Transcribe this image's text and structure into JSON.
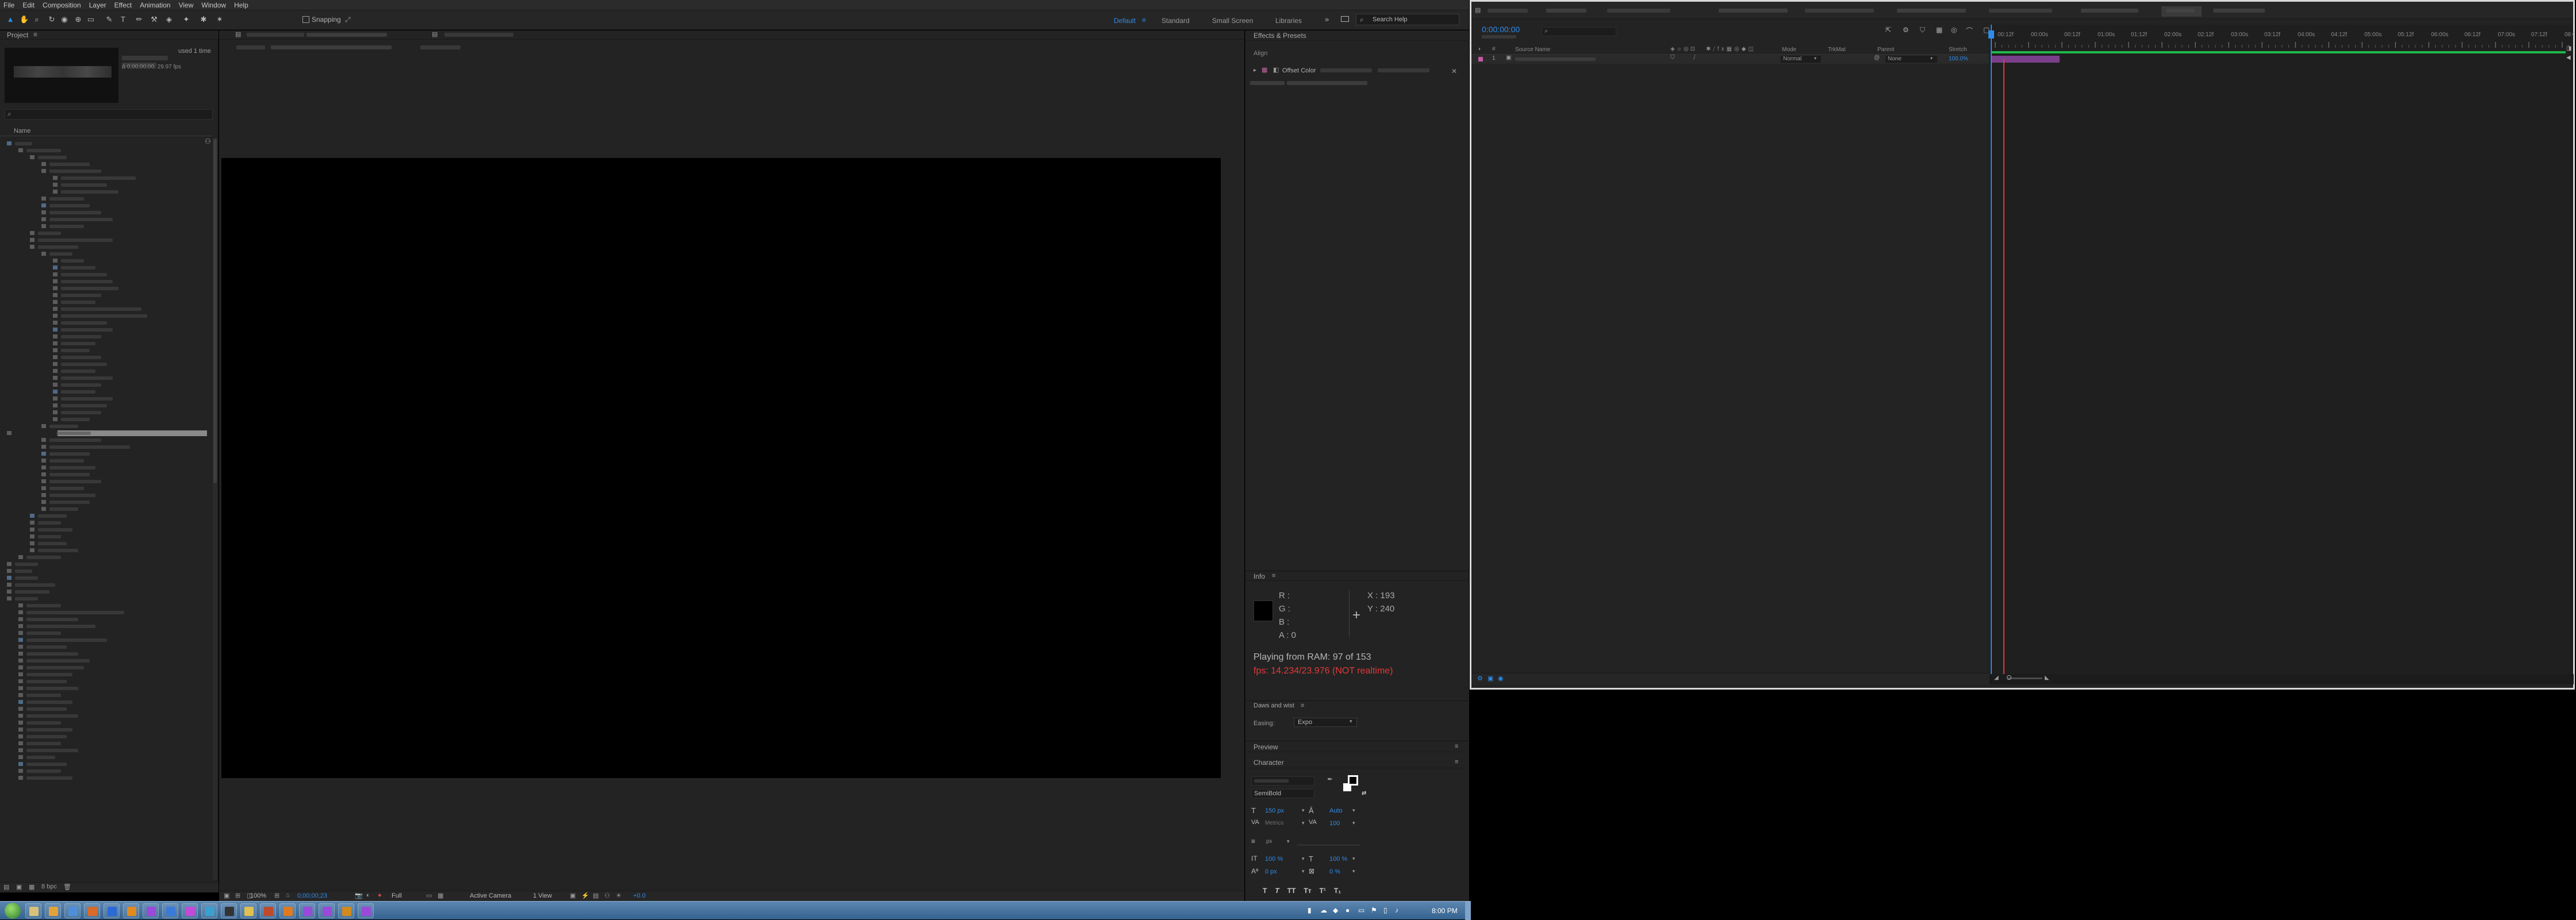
{
  "menu": {
    "items": [
      "File",
      "Edit",
      "Composition",
      "Layer",
      "Effect",
      "Animation",
      "View",
      "Window",
      "Help"
    ]
  },
  "toolbar": {
    "snapping_label": "Snapping",
    "workspaces": [
      "Default",
      "Standard",
      "Small Screen",
      "Libraries"
    ],
    "search_placeholder": "Search Help",
    "accent": "#2d8ceb"
  },
  "project": {
    "title": "Project",
    "used_times": "used 1 time",
    "footage_info": "∆ 0;00;00;00, 29.97 fps",
    "search_icon": "search-icon",
    "column_name": "Name"
  },
  "effects_presets": {
    "title": "Effects & Presets",
    "section": "Align",
    "item": "Offset Color"
  },
  "info": {
    "title": "Info",
    "r": "R :",
    "g": "G :",
    "b": "B :",
    "a": "A : 0",
    "x": "X : 193",
    "y": "Y : 240",
    "playing": "Playing from RAM: 97 of 153",
    "fps": "fps: 14.234/23.976 (NOT realtime)"
  },
  "align": {
    "title": "Daws and wist",
    "easing_label": "Easing:",
    "easing_value": "Expo"
  },
  "preview": {
    "title": "Preview"
  },
  "character": {
    "title": "Character",
    "font_style": "SemiBold",
    "size": "150 px",
    "leading": "Auto",
    "kerning": "Metrics",
    "tracking": "100",
    "stroke": "px",
    "vscale": "100 %",
    "hscale": "100 %",
    "baseline": "0 px",
    "tsume": "0 %",
    "style_buttons": [
      "T",
      "T",
      "TT",
      "Tт",
      "T¹",
      "T₁"
    ]
  },
  "viewer": {
    "zoom": "100%",
    "timecode": "0;00;00;23",
    "resolution": "Full",
    "camera": "Active Camera",
    "views": "1 View",
    "exposure": "+0.0"
  },
  "timeline": {
    "timecode": "0:00:00:00",
    "columns": {
      "source_name": "Source Name",
      "mode": "Mode",
      "trkmat": "TrkMat",
      "parent": "Parent",
      "stretch": "Stretch"
    },
    "layer": {
      "mode": "Normal",
      "parent": "None",
      "stretch": "100.0%"
    },
    "ruler": [
      "00:12f",
      "00:00s",
      "00:12f",
      "01:00s",
      "01:12f",
      "02:00s",
      "02:12f",
      "03:00s",
      "03:12f",
      "04:00s",
      "04:12f",
      "05:00s",
      "05:12f",
      "06:00s",
      "06:12f",
      "07:00s",
      "07:12f",
      "08:00s"
    ],
    "work_area_color": "#1fb84a",
    "playhead_color": "#e03a3a",
    "layer_bar_color": "#7a3f8a"
  },
  "taskbar": {
    "clock": "8:00 PM",
    "apps": [
      "windows-start",
      "explorer",
      "chrome",
      "firefox",
      "photoshop",
      "illustrator",
      "premiere",
      "media-encoder",
      "after-effects",
      "audition",
      "terminal",
      "notes",
      "bridge",
      "vlc",
      "ae-2",
      "ae-3",
      "ai-2",
      "ae-4",
      "vlc-2"
    ]
  }
}
